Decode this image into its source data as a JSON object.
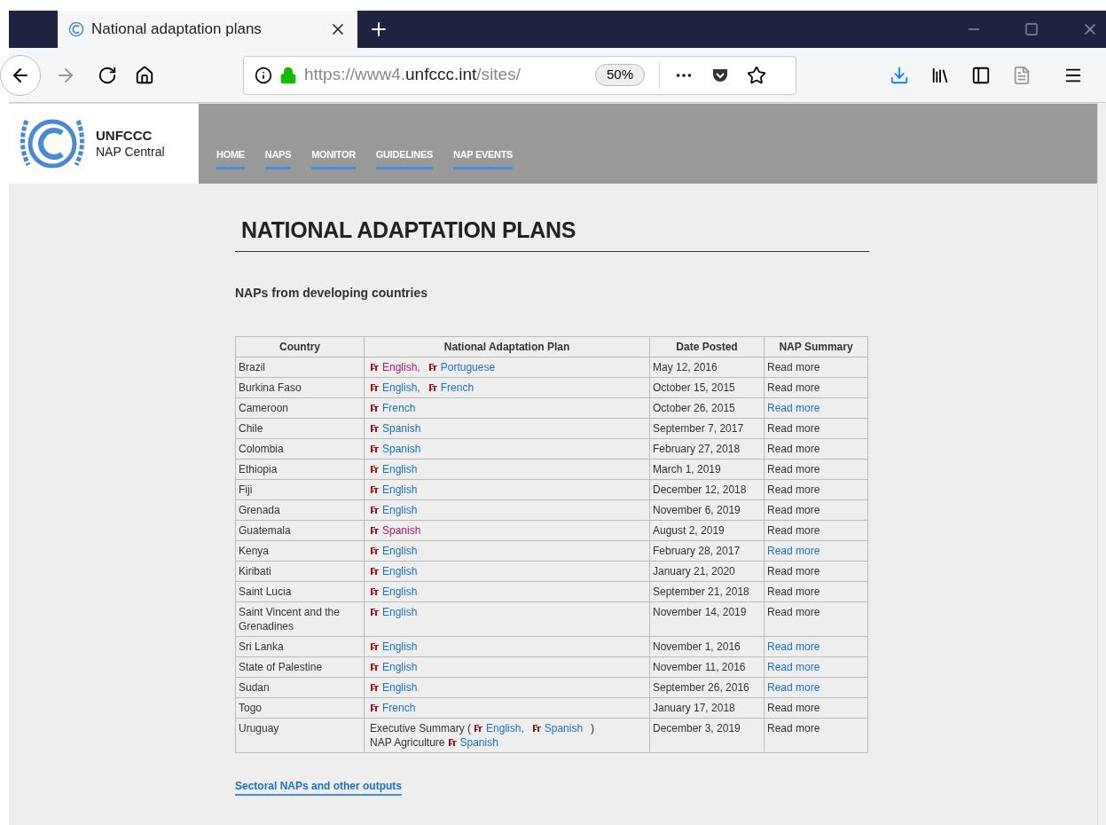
{
  "browser": {
    "tab_title": "National adaptation plans",
    "url": {
      "prefix": "https://www4.",
      "domain": "unfccc.int",
      "path": "/sites/"
    },
    "zoom": "50%"
  },
  "site": {
    "logo_title": "UNFCCC",
    "logo_subtitle": "NAP Central",
    "nav": [
      "HOME",
      "NAPS",
      "MONITOR",
      "GUIDELINES",
      "NAP EVENTS"
    ]
  },
  "page": {
    "heading": "NATIONAL ADAPTATION PLANS",
    "subheading": "NAPs from developing countries",
    "table": {
      "columns": [
        "Country",
        "National Adaptation Plan",
        "Date Posted",
        "NAP Summary"
      ],
      "rows": [
        {
          "country": "Brazil",
          "plan": [
            [
              {
                "kind": "pdf",
                "text": "English,",
                "visited": true
              },
              {
                "kind": "pdf",
                "text": "Portuguese",
                "visited": false
              }
            ]
          ],
          "date": "May 12, 2016",
          "summary": {
            "kind": "text",
            "text": "Read more"
          }
        },
        {
          "country": "Burkina Faso",
          "plan": [
            [
              {
                "kind": "pdf",
                "text": "English,",
                "visited": false
              },
              {
                "kind": "pdf",
                "text": "French",
                "visited": false
              }
            ]
          ],
          "date": "October 15, 2015",
          "summary": {
            "kind": "text",
            "text": "Read more"
          }
        },
        {
          "country": "Cameroon",
          "plan": [
            [
              {
                "kind": "pdf",
                "text": "French",
                "visited": false
              }
            ]
          ],
          "date": "October 26, 2015",
          "summary": {
            "kind": "link",
            "text": "Read more"
          }
        },
        {
          "country": "Chile",
          "plan": [
            [
              {
                "kind": "pdf",
                "text": "Spanish",
                "visited": false
              }
            ]
          ],
          "date": "September 7, 2017",
          "summary": {
            "kind": "text",
            "text": "Read more"
          }
        },
        {
          "country": "Colombia",
          "plan": [
            [
              {
                "kind": "pdf",
                "text": "Spanish",
                "visited": false
              }
            ]
          ],
          "date": "February 27, 2018",
          "summary": {
            "kind": "text",
            "text": "Read more"
          }
        },
        {
          "country": "Ethiopia",
          "plan": [
            [
              {
                "kind": "pdf",
                "text": "English",
                "visited": false
              }
            ]
          ],
          "date": "March 1, 2019",
          "summary": {
            "kind": "text",
            "text": "Read more"
          }
        },
        {
          "country": "Fiji",
          "plan": [
            [
              {
                "kind": "pdf",
                "text": "English",
                "visited": false
              }
            ]
          ],
          "date": "December 12, 2018",
          "summary": {
            "kind": "text",
            "text": "Read more"
          }
        },
        {
          "country": "Grenada",
          "plan": [
            [
              {
                "kind": "pdf",
                "text": "English",
                "visited": false
              }
            ]
          ],
          "date": "November 6, 2019",
          "summary": {
            "kind": "text",
            "text": "Read more"
          }
        },
        {
          "country": "Guatemala",
          "plan": [
            [
              {
                "kind": "pdf",
                "text": "Spanish",
                "visited": true
              }
            ]
          ],
          "date": "August 2, 2019",
          "summary": {
            "kind": "text",
            "text": "Read more"
          }
        },
        {
          "country": "Kenya",
          "plan": [
            [
              {
                "kind": "pdf",
                "text": "English",
                "visited": false
              }
            ]
          ],
          "date": "February 28, 2017",
          "summary": {
            "kind": "link",
            "text": "Read more"
          }
        },
        {
          "country": "Kiribati",
          "plan": [
            [
              {
                "kind": "pdf",
                "text": "English",
                "visited": false
              }
            ]
          ],
          "date": "January 21, 2020",
          "summary": {
            "kind": "text",
            "text": "Read more"
          }
        },
        {
          "country": "Saint Lucia",
          "plan": [
            [
              {
                "kind": "pdf",
                "text": "English",
                "visited": false
              }
            ]
          ],
          "date": "September 21, 2018",
          "summary": {
            "kind": "text",
            "text": "Read more"
          }
        },
        {
          "country": "Saint Vincent and the Grenadines",
          "plan": [
            [
              {
                "kind": "pdf",
                "text": "English",
                "visited": false
              }
            ]
          ],
          "date": "November 14, 2019",
          "summary": {
            "kind": "text",
            "text": "Read more"
          }
        },
        {
          "country": "Sri Lanka",
          "plan": [
            [
              {
                "kind": "pdf",
                "text": "English",
                "visited": false
              }
            ]
          ],
          "date": "November 1, 2016",
          "summary": {
            "kind": "link",
            "text": "Read more"
          }
        },
        {
          "country": "State of Palestine",
          "plan": [
            [
              {
                "kind": "pdf",
                "text": "English",
                "visited": false
              }
            ]
          ],
          "date": "November 11, 2016",
          "summary": {
            "kind": "link",
            "text": "Read more"
          }
        },
        {
          "country": "Sudan",
          "plan": [
            [
              {
                "kind": "pdf",
                "text": "English",
                "visited": false
              }
            ]
          ],
          "date": "September 26, 2016",
          "summary": {
            "kind": "link",
            "text": "Read more"
          }
        },
        {
          "country": "Togo",
          "plan": [
            [
              {
                "kind": "pdf",
                "text": "French",
                "visited": false
              }
            ]
          ],
          "date": "January 17, 2018",
          "summary": {
            "kind": "text",
            "text": "Read more"
          }
        },
        {
          "country": "Uruguay",
          "plan": [
            [
              {
                "kind": "text",
                "text": "Executive Summary ("
              },
              {
                "kind": "pdf",
                "text": "English,",
                "visited": false
              },
              {
                "kind": "pdf",
                "text": "Spanish",
                "visited": false
              },
              {
                "kind": "text",
                "text": ")"
              }
            ],
            [
              {
                "kind": "text",
                "text": "NAP Agriculture"
              },
              {
                "kind": "pdf",
                "text": "Spanish",
                "visited": false
              }
            ]
          ],
          "date": "December 3, 2019",
          "summary": {
            "kind": "text",
            "text": "Read more"
          }
        }
      ]
    },
    "footer_link": "Sectoral NAPs and other outputs"
  }
}
